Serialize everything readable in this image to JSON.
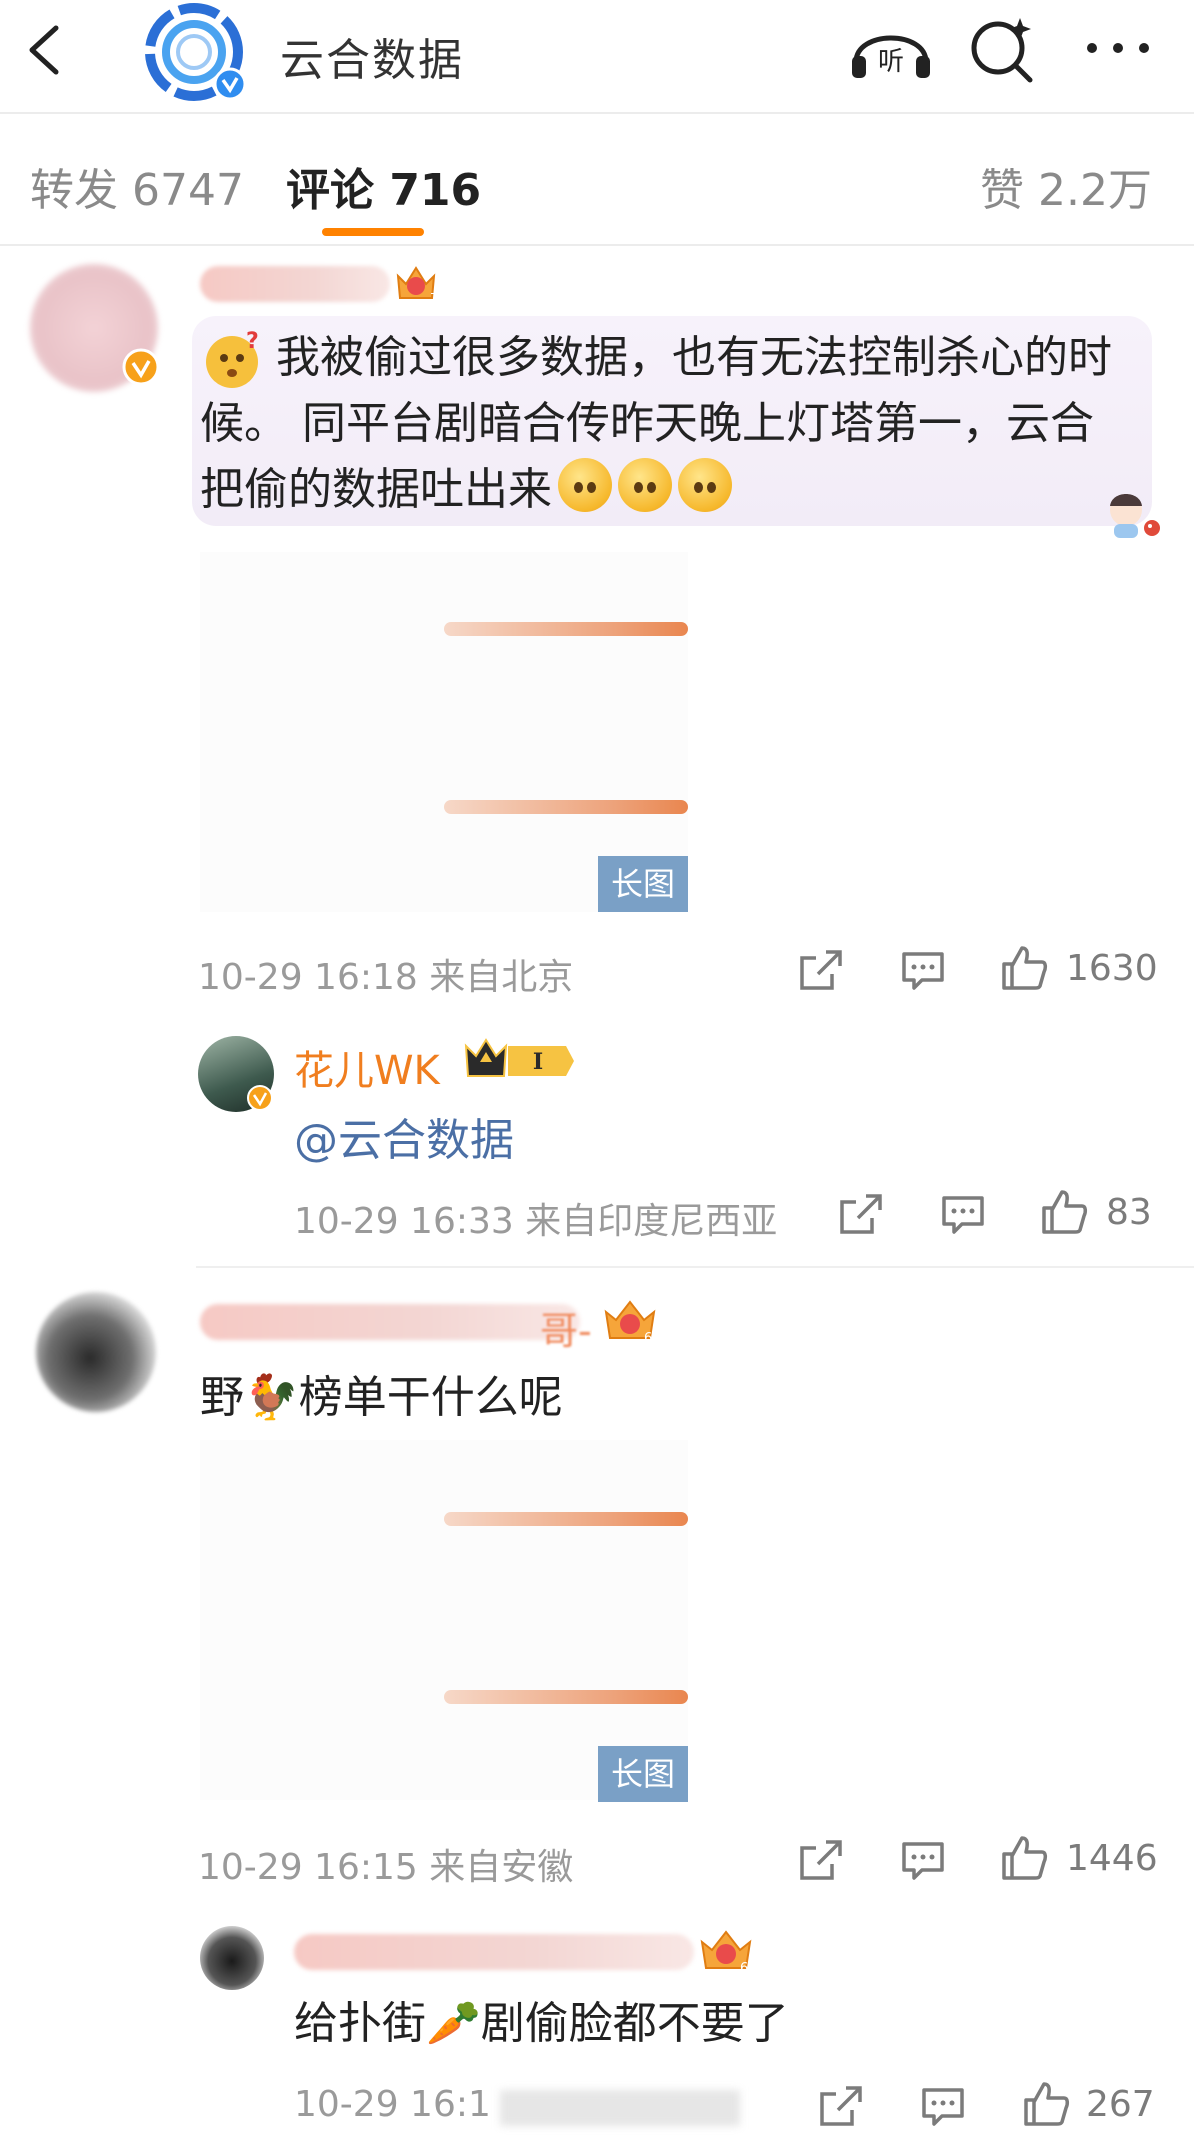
{
  "header": {
    "title": "云合数据"
  },
  "tabs": {
    "repost": "转发 6747",
    "comments": "评论 716",
    "likes": "赞 2.2万"
  },
  "comments": [
    {
      "text_line1": "我被偷过很多数据，也有无法控制杀心的时",
      "text_line2": "候。 同平台剧暗合传昨天晚上灯塔第一，云合",
      "text_line3": "把偷的数据吐出来",
      "badge_level": "7",
      "long_image_tag": "长图",
      "time": "10-29 16:18 来自北京",
      "likes": "1630",
      "reply": {
        "name": "花儿WK",
        "vip_level": "I",
        "text": "@云合数据",
        "time": "10-29 16:33 来自印度尼西亚",
        "likes": "83"
      }
    },
    {
      "name_suffix": "哥-",
      "text": "野🐓榜单干什么呢",
      "badge_level": "6",
      "long_image_tag": "长图",
      "time": "10-29 16:15 来自安徽",
      "likes": "1446",
      "reply": {
        "text": "给扑街🥕剧偷脸都不要了",
        "badge_level": "6",
        "time": "10-29 16:1",
        "likes": "267"
      }
    }
  ],
  "icons": {
    "back": "chevron-left-icon",
    "listen": "headphones-listen-icon",
    "search": "search-sparkle-icon",
    "more": "more-dots-icon",
    "repost": "repost-icon",
    "comment": "comment-icon",
    "like": "thumbs-up-icon"
  },
  "colors": {
    "accent": "#ff8200",
    "mention": "#4b6fa5",
    "reply_name": "#f07e1f"
  }
}
